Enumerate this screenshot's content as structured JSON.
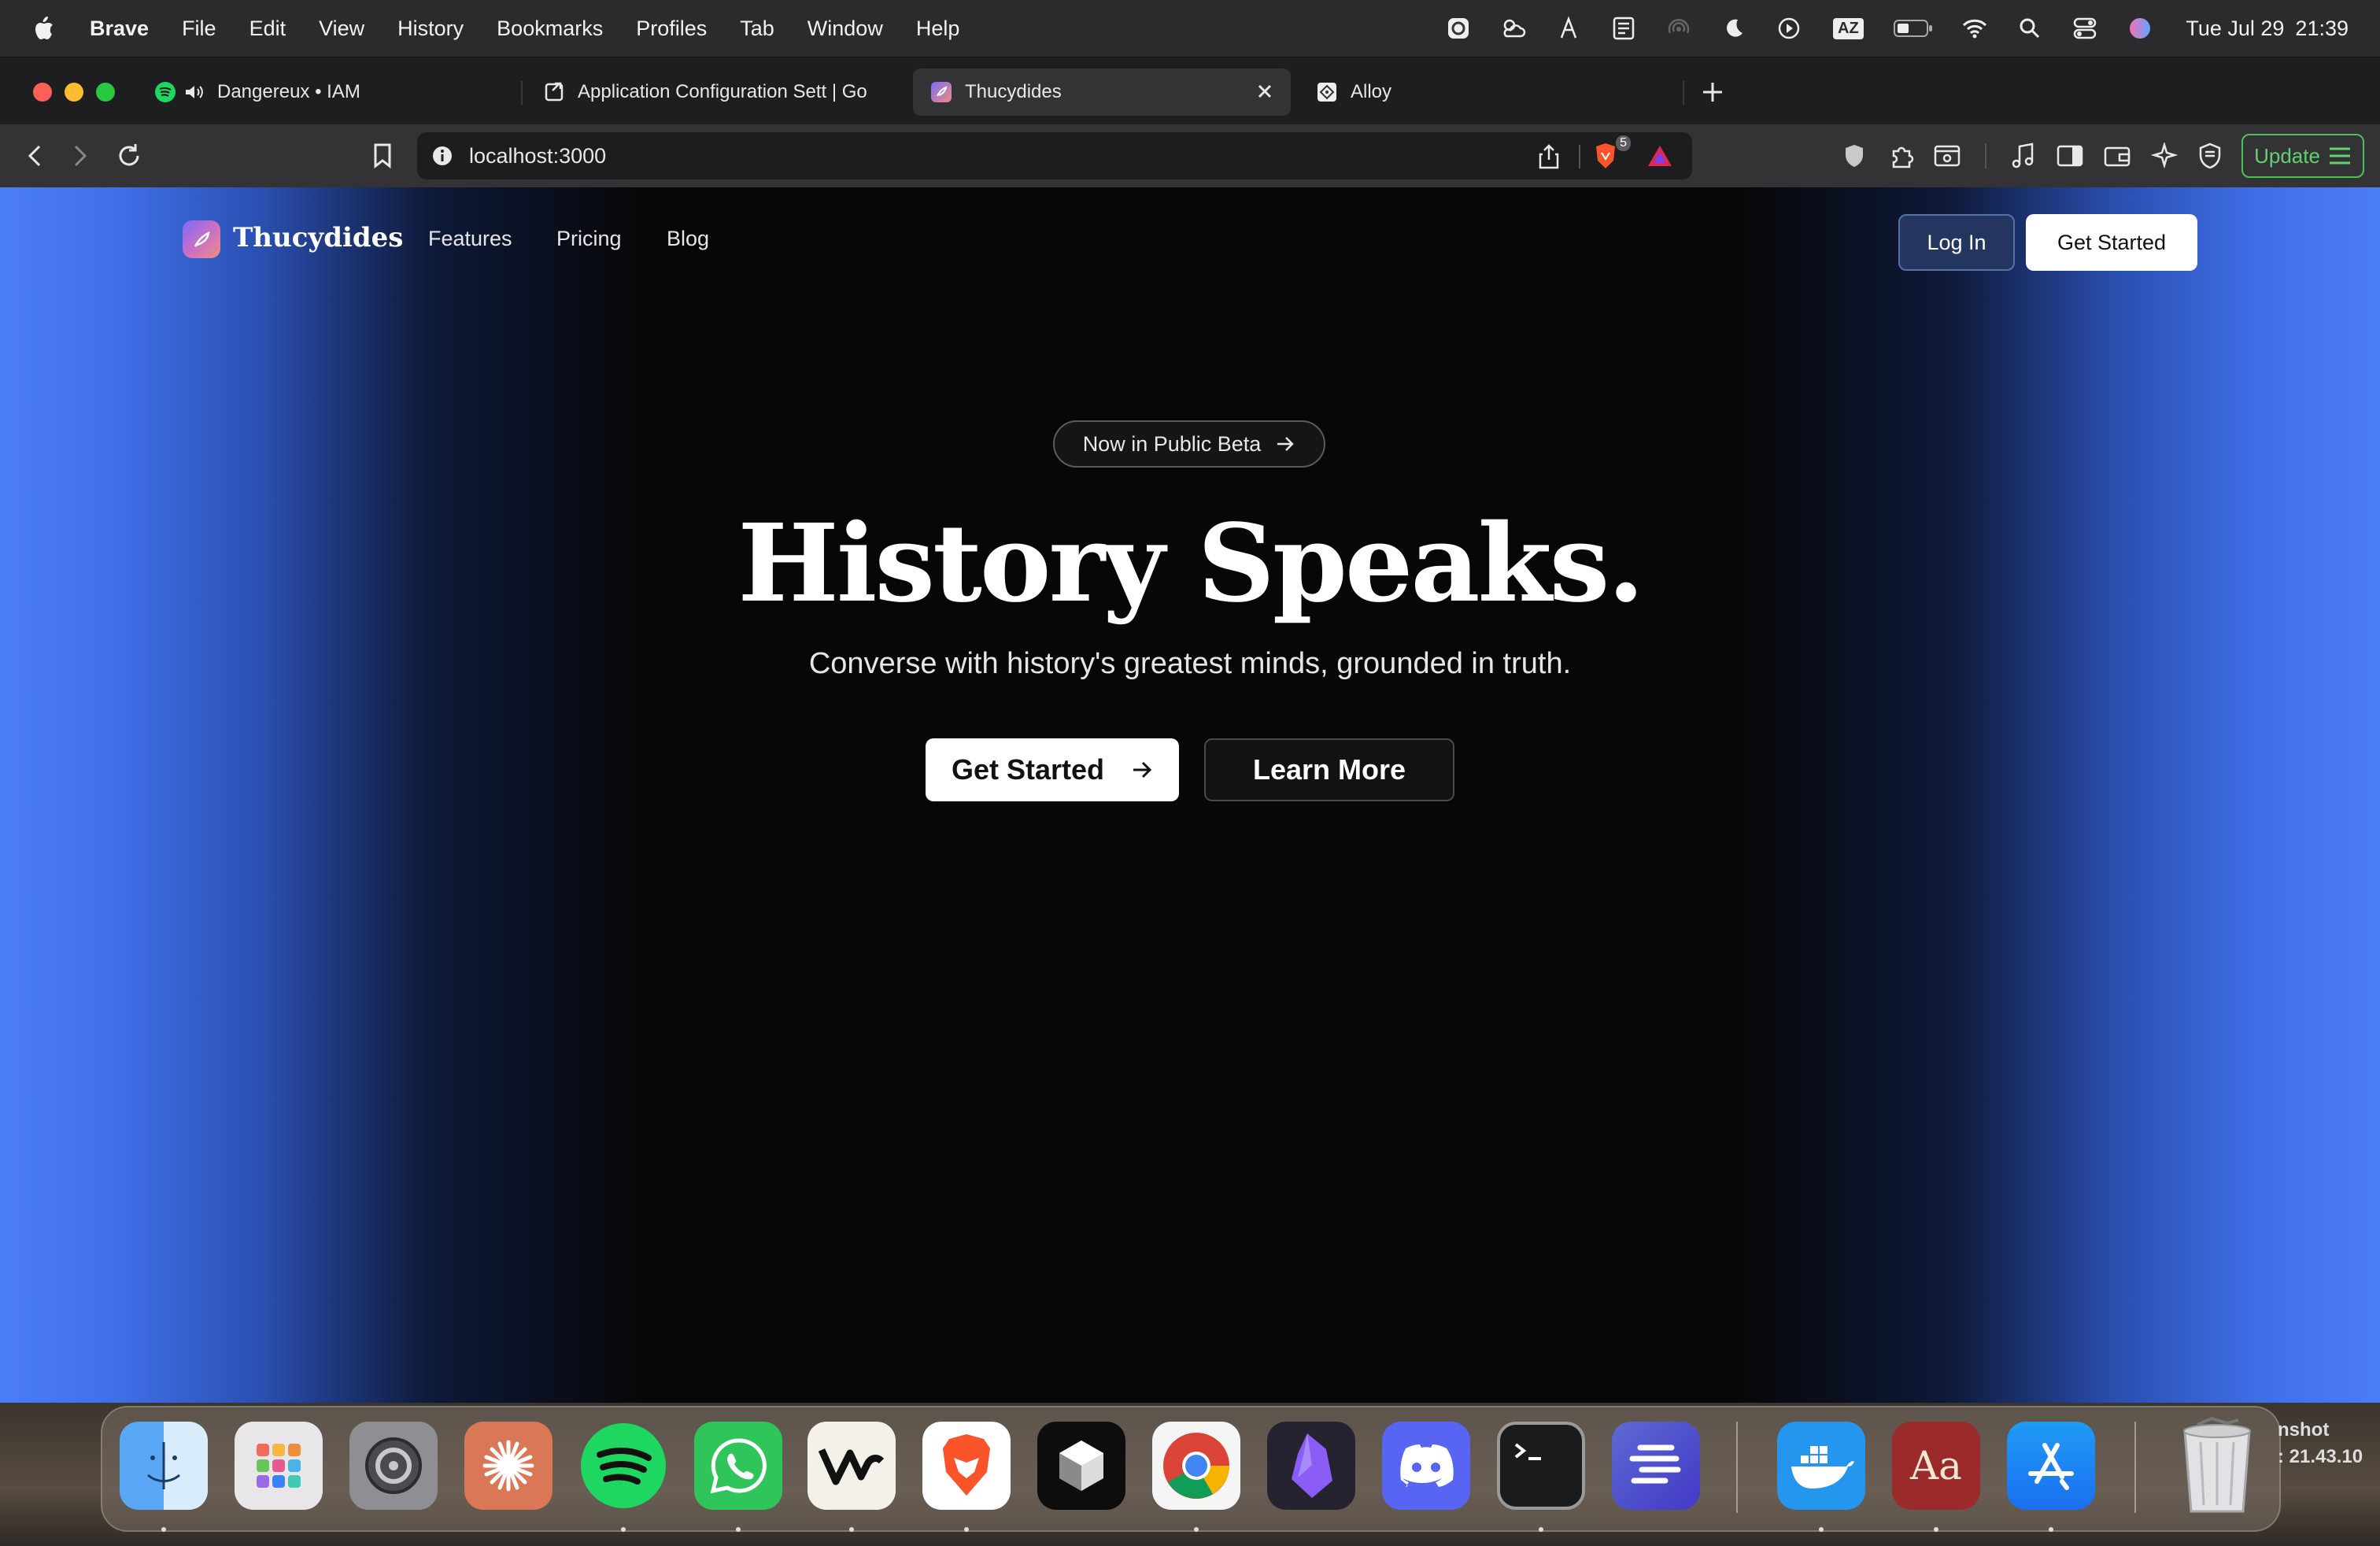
{
  "menubar": {
    "app_name": "Brave",
    "items": [
      "File",
      "Edit",
      "View",
      "History",
      "Bookmarks",
      "Profiles",
      "Tab",
      "Window",
      "Help"
    ],
    "status_icons": [
      "tool-icon",
      "weather-icon",
      "character-icon",
      "document-icon",
      "airdrop-icon",
      "moon-icon",
      "play-icon",
      "keyboard-layout-icon",
      "battery-icon",
      "wifi-icon",
      "spotlight-search-icon",
      "control-center-icon",
      "siri-icon"
    ],
    "keyboard_layout": "AZ",
    "date": "Tue Jul 29",
    "time": "21:39"
  },
  "tabs": [
    {
      "title": "Dangereux • IAM",
      "favicon": "spotify-icon"
    },
    {
      "title": "Application Configuration Sett | Go",
      "favicon": "external-link-icon"
    },
    {
      "title": "Thucydides",
      "favicon": "thucydides-icon",
      "active": true
    },
    {
      "title": "Alloy",
      "favicon": "alloy-icon"
    }
  ],
  "toolbar": {
    "url": "localhost:3000",
    "shields_count": "5",
    "update_label": "Update"
  },
  "site": {
    "logo_text": "Thucydides",
    "nav": [
      "Features",
      "Pricing",
      "Blog"
    ],
    "login_label": "Log In",
    "cta_label": "Get Started"
  },
  "hero": {
    "badge": "Now in Public Beta",
    "title": "History Speaks.",
    "subtitle": "Converse with history's greatest minds, grounded in truth.",
    "primary_label": "Get Started",
    "secondary_label": "Learn More"
  },
  "dock": {
    "apps": [
      "Finder",
      "Launchpad",
      "System Settings",
      "Claude",
      "Spotify",
      "WhatsApp",
      "Warp",
      "Brave",
      "Perplexity",
      "Chrome",
      "Obsidian",
      "Discord",
      "Terminal",
      "Linear",
      "Docker",
      "Dictionary",
      "App Store"
    ],
    "trash": "Trash",
    "screenshot_label": [
      "nshot",
      ": 21.43.10"
    ]
  },
  "colors": {
    "accent_blue": "#4b7df7",
    "update_green": "#4cc15a"
  }
}
